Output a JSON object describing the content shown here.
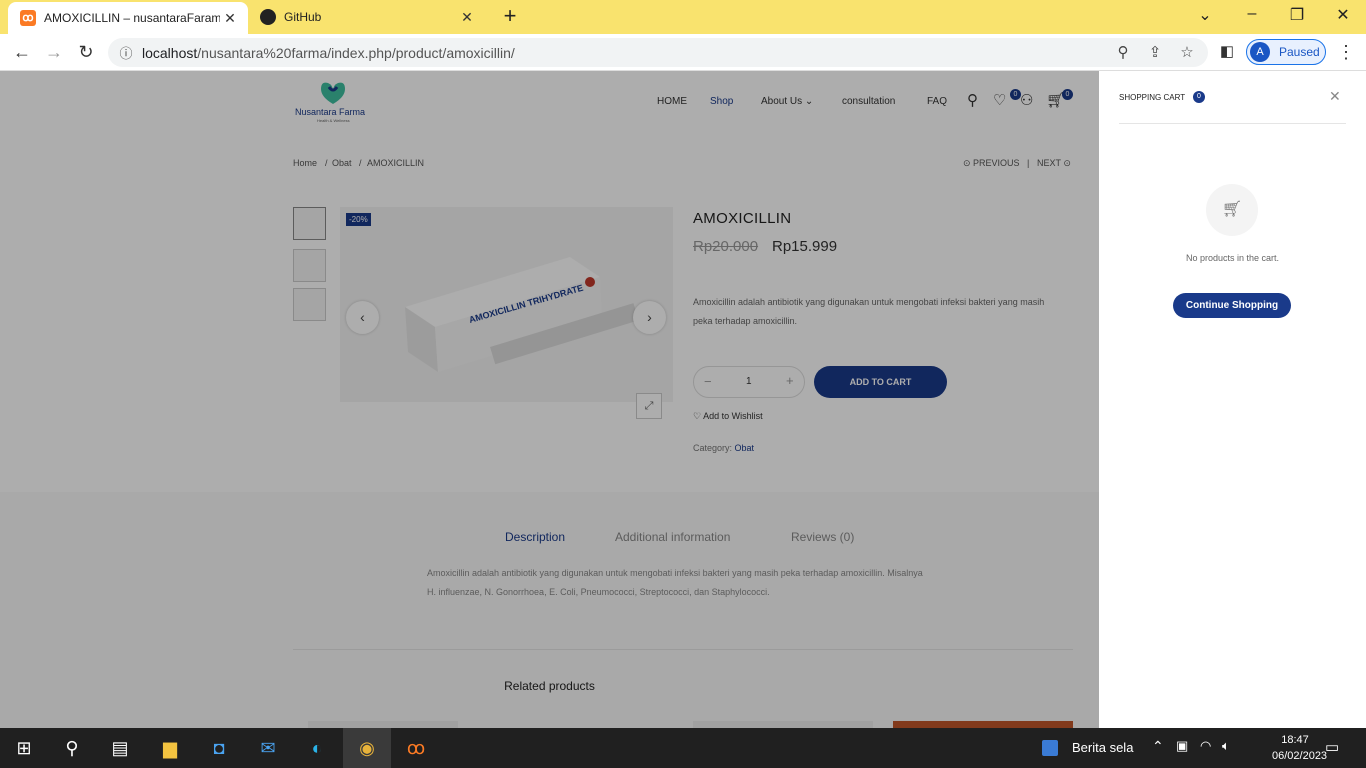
{
  "browser": {
    "tabs": [
      {
        "title": "AMOXICILLIN – nusantaraFarama",
        "active": true
      },
      {
        "title": "GitHub",
        "active": false
      }
    ],
    "url_host": "localhost",
    "url_path": "/nusantara%20farma/index.php/product/amoxicillin/",
    "profile_initial": "A",
    "profile_status": "Paused"
  },
  "site": {
    "logo_text": "Nusantara Farma",
    "logo_sub": "Health & Wellness",
    "nav": [
      "HOME",
      "Shop",
      "About Us",
      "consultation",
      "FAQ"
    ],
    "wishlist_count": "0",
    "cart_count": "0",
    "breadcrumb": [
      "Home",
      "Obat",
      "AMOXICILLIN"
    ],
    "prev_label": "PREVIOUS",
    "next_label": "NEXT"
  },
  "product": {
    "sale_badge": "-20%",
    "title": "AMOXICILLIN",
    "old_price": "Rp20.000",
    "new_price": "Rp15.999",
    "short_description": "Amoxicillin adalah antibiotik yang digunakan untuk mengobati infeksi bakteri yang masih peka terhadap amoxicillin.",
    "quantity": "1",
    "add_to_cart": "ADD TO CART",
    "wishlist": "Add to Wishlist",
    "category_label": "Category:",
    "category_value": "Obat",
    "box_text": "AMOXICILLIN TRIHYDRATE"
  },
  "tabs": {
    "items": [
      "Description",
      "Additional information",
      "Reviews (0)"
    ],
    "description": "Amoxicillin adalah antibiotik yang digunakan untuk mengobati infeksi bakteri yang masih peka terhadap amoxicillin. Misalnya H. influenzae, N. Gonorrhoea, E. Coli, Pneumococci, Streptococci, dan Staphylococci.",
    "related_title": "Related products"
  },
  "cart": {
    "title": "SHOPPING CART",
    "count": "0",
    "empty_text": "No products in the cart.",
    "continue": "Continue Shopping"
  },
  "taskbar": {
    "news": "Berita sela",
    "time": "18:47",
    "date": "06/02/2023"
  },
  "colors": {
    "brand": "#1a3a8a",
    "tabbar": "#f9e36e",
    "taskbar": "#202020"
  }
}
